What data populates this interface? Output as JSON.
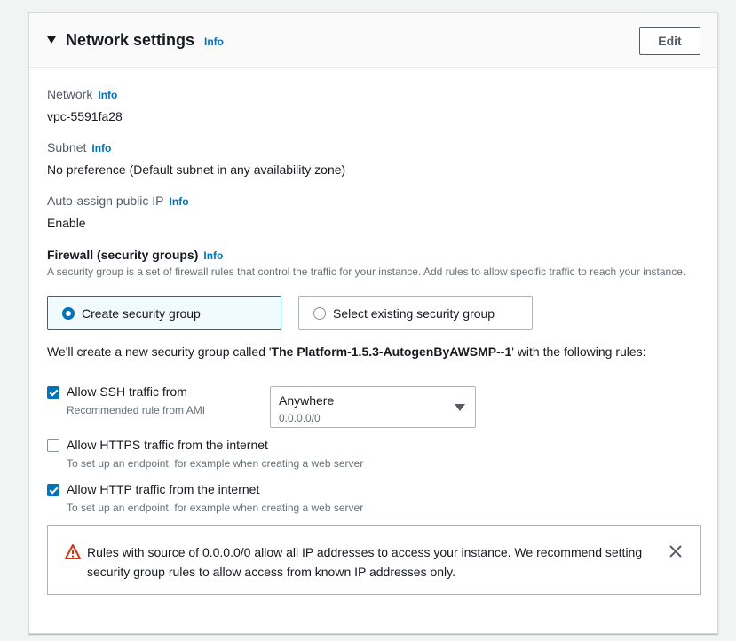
{
  "header": {
    "title": "Network settings",
    "info": "Info",
    "edit_label": "Edit"
  },
  "network": {
    "label": "Network",
    "info": "Info",
    "value": "vpc-5591fa28"
  },
  "subnet": {
    "label": "Subnet",
    "info": "Info",
    "value": "No preference (Default subnet in any availability zone)"
  },
  "auto_ip": {
    "label": "Auto-assign public IP",
    "info": "Info",
    "value": "Enable"
  },
  "firewall": {
    "title": "Firewall (security groups)",
    "info": "Info",
    "description": "A security group is a set of firewall rules that control the traffic for your instance. Add rules to allow specific traffic to reach your instance.",
    "options": [
      {
        "label": "Create security group",
        "selected": true
      },
      {
        "label": "Select existing security group",
        "selected": false
      }
    ],
    "sg_prefix": "We'll create a new security group called '",
    "sg_name": "The Platform-1.5.3-AutogenByAWSMP--1",
    "sg_suffix": "' with the following rules:"
  },
  "rules": [
    {
      "label": "Allow SSH traffic from",
      "sub": "Recommended rule from AMI",
      "checked": true
    },
    {
      "label": "Allow HTTPS traffic from the internet",
      "sub": "To set up an endpoint, for example when creating a web server",
      "checked": false
    },
    {
      "label": "Allow HTTP traffic from the internet",
      "sub": "To set up an endpoint, for example when creating a web server",
      "checked": true
    }
  ],
  "ssh_source": {
    "value": "Anywhere",
    "sub": "0.0.0.0/0"
  },
  "alert": {
    "text": "Rules with source of 0.0.0.0/0 allow all IP addresses to access your instance. We recommend setting security group rules to allow access from known IP addresses only."
  },
  "colors": {
    "accent": "#0073bb",
    "warning": "#d13212"
  }
}
